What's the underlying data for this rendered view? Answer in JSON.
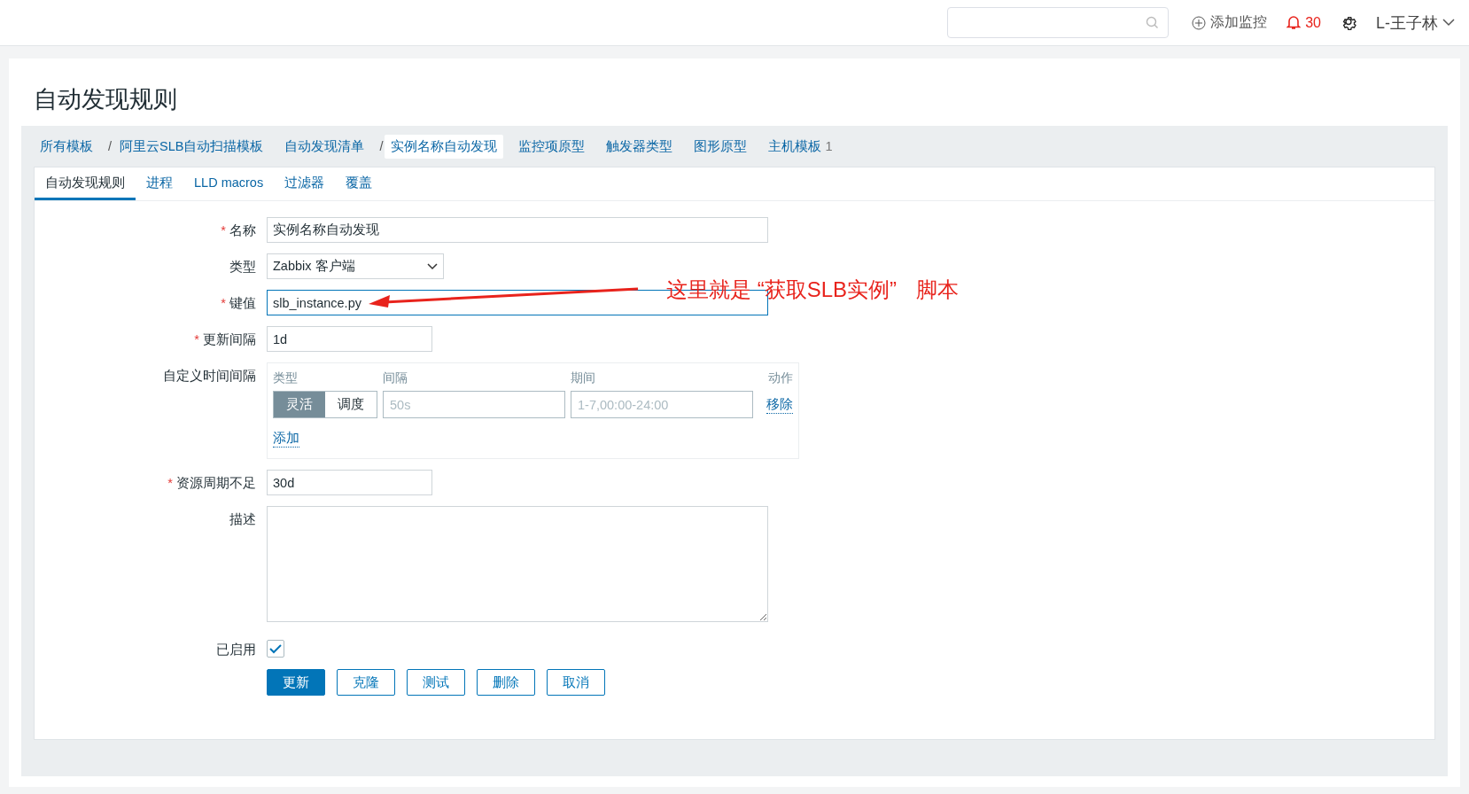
{
  "header": {
    "add_monitor": "添加监控",
    "alert_count": "30",
    "user": "L-王子林"
  },
  "page_title": "自动发现规则",
  "breadcrumbs": [
    {
      "label": "所有模板",
      "selected": false,
      "separator": "/"
    },
    {
      "label": "阿里云SLB自动扫描模板",
      "selected": false
    },
    {
      "label": "自动发现清单",
      "selected": false,
      "separator": "/"
    },
    {
      "label": "实例名称自动发现",
      "selected": true
    },
    {
      "label": "监控项原型",
      "selected": false
    },
    {
      "label": "触发器类型",
      "selected": false
    },
    {
      "label": "图形原型",
      "selected": false
    },
    {
      "label": "主机模板",
      "selected": false,
      "count": "1"
    }
  ],
  "tabs": [
    {
      "label": "自动发现规则",
      "selected": true
    },
    {
      "label": "进程",
      "selected": false
    },
    {
      "label": "LLD macros",
      "selected": false
    },
    {
      "label": "过滤器",
      "selected": false
    },
    {
      "label": "覆盖",
      "selected": false
    }
  ],
  "fields": [
    {
      "kind": "text",
      "label": "名称",
      "required_mark": "*",
      "value": "实例名称自动发现",
      "wide": true,
      "focused": false
    },
    {
      "kind": "select",
      "label": "类型",
      "value": "Zabbix 客户端"
    },
    {
      "kind": "text",
      "label": "键值",
      "required_mark": "*",
      "value": "slb_instance.py",
      "wide": true,
      "focused": true
    },
    {
      "kind": "text",
      "label": "更新间隔",
      "required_mark": "*",
      "value": "1d",
      "wide": false,
      "focused": false
    },
    {
      "kind": "intervals",
      "label": "自定义时间间隔",
      "columns": [
        "类型",
        "间隔",
        "期间",
        "动作"
      ],
      "rows": [
        {
          "modes": [
            {
              "label": "灵活",
              "selected": true
            },
            {
              "label": "调度",
              "selected": false
            }
          ],
          "interval_placeholder": "50s",
          "period_placeholder": "1-7,00:00-24:00",
          "remove": "移除"
        }
      ],
      "add": "添加"
    },
    {
      "kind": "text",
      "label": "资源周期不足",
      "required_mark": "*",
      "value": "30d",
      "wide": false,
      "focused": false
    },
    {
      "kind": "textarea",
      "label": "描述"
    },
    {
      "kind": "checkbox",
      "label": "已启用",
      "checked": true
    }
  ],
  "buttons": [
    {
      "label": "更新",
      "primary": true
    },
    {
      "label": "克隆",
      "primary": false
    },
    {
      "label": "测试",
      "primary": false
    },
    {
      "label": "删除",
      "primary": false
    },
    {
      "label": "取消",
      "primary": false
    }
  ],
  "annotation": {
    "texts": [
      "这里就是 “获取SLB实例”",
      "脚本"
    ]
  }
}
